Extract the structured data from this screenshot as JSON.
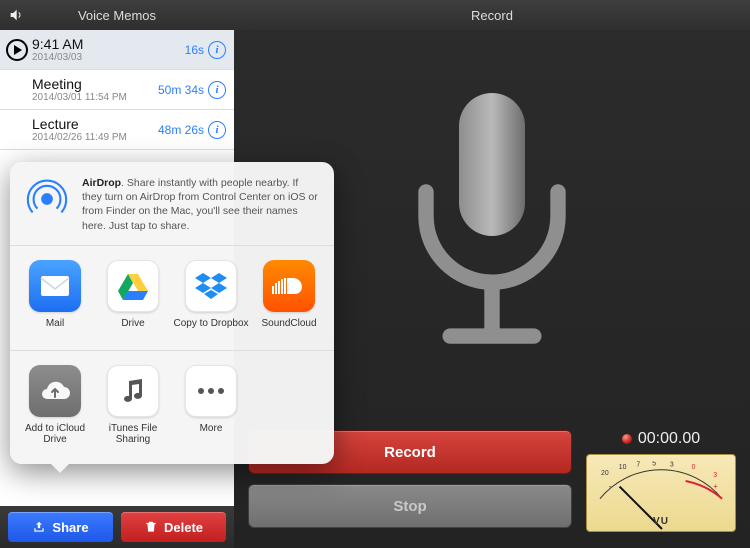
{
  "left": {
    "title": "Voice Memos",
    "memos": [
      {
        "title": "9:41 AM",
        "subtitle": "2014/03/03",
        "duration": "16s",
        "selected": true,
        "playable": true
      },
      {
        "title": "Meeting",
        "subtitle": "2014/03/01 11:54 PM",
        "duration": "50m 34s",
        "selected": false,
        "playable": false
      },
      {
        "title": "Lecture",
        "subtitle": "2014/02/26 11:49 PM",
        "duration": "48m 26s",
        "selected": false,
        "playable": false
      }
    ],
    "share_button": "Share",
    "delete_button": "Delete"
  },
  "right": {
    "title": "Record",
    "record_button": "Record",
    "stop_button": "Stop",
    "timer": "00:00.00",
    "vu_label": "VU",
    "vu_ticks_left": [
      "20",
      "10",
      "7",
      "5",
      "3"
    ],
    "vu_ticks_right": [
      "0",
      "3"
    ]
  },
  "share_sheet": {
    "airdrop_bold": "AirDrop",
    "airdrop_rest": ". Share instantly with people nearby. If they turn on AirDrop from Control Center on iOS or from Finder on the Mac, you'll see their names here. Just tap to share.",
    "apps": [
      {
        "label": "Mail",
        "tile": "mail"
      },
      {
        "label": "Drive",
        "tile": "drive"
      },
      {
        "label": "Copy to Dropbox",
        "tile": "dropbox"
      },
      {
        "label": "SoundCloud",
        "tile": "soundcloud"
      }
    ],
    "activities": [
      {
        "label": "Add to iCloud Drive",
        "tile": "icloud"
      },
      {
        "label": "iTunes File Sharing",
        "tile": "itunes"
      },
      {
        "label": "More",
        "tile": "more"
      }
    ]
  }
}
